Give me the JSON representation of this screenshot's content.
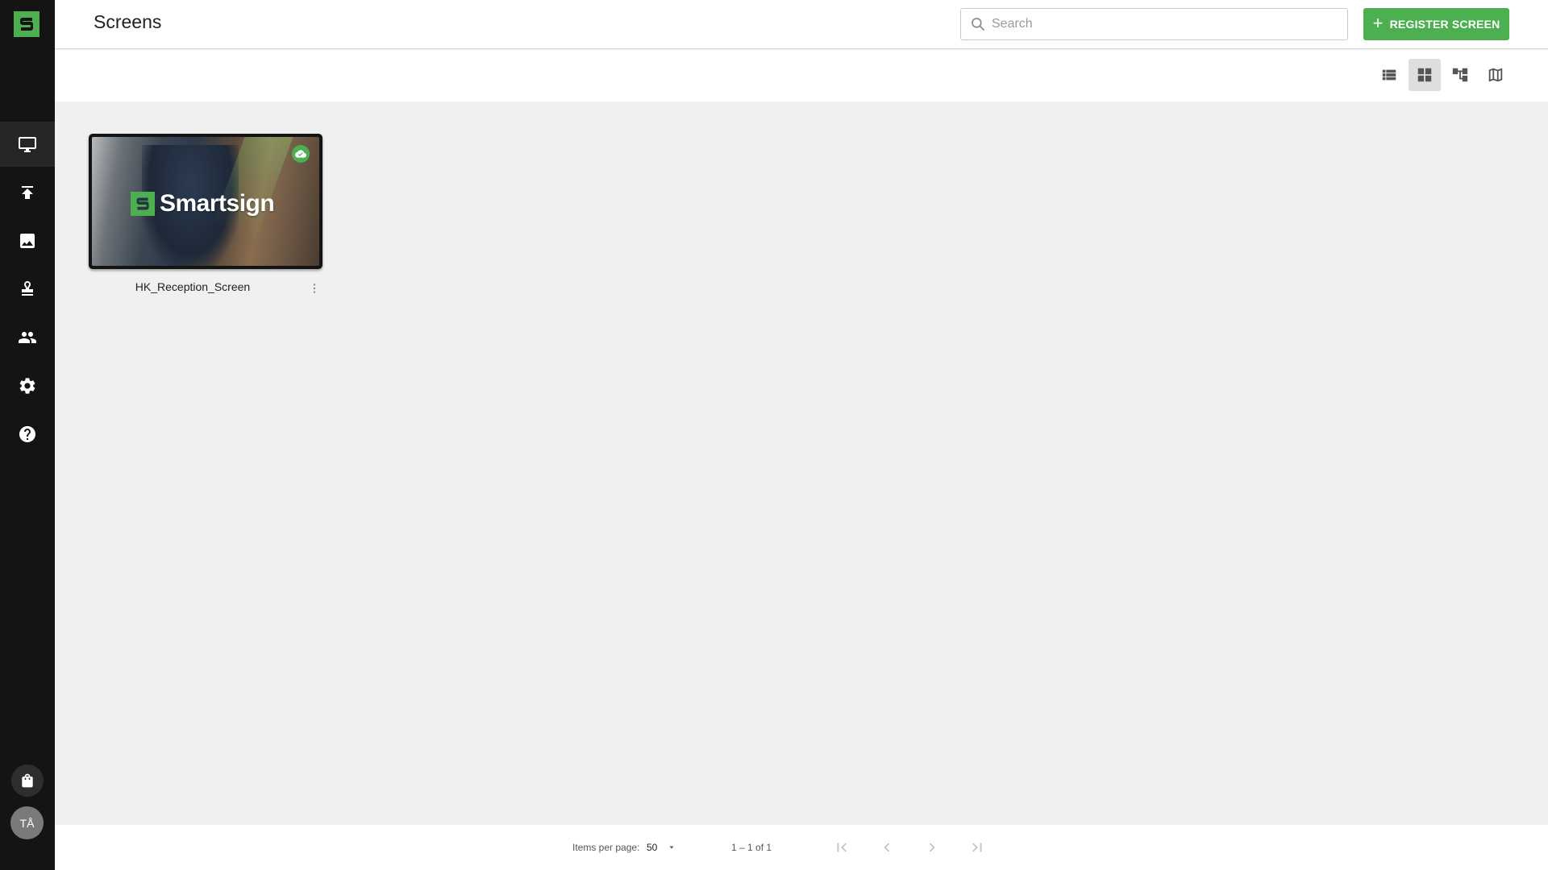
{
  "header": {
    "title": "Screens",
    "search_placeholder": "Search",
    "register_label": "REGISTER SCREEN"
  },
  "sidebar": {
    "items": [
      {
        "icon": "monitor-icon",
        "name": "screens",
        "active": true
      },
      {
        "icon": "upload-icon",
        "name": "publish",
        "active": false
      },
      {
        "icon": "image-icon",
        "name": "media",
        "active": false
      },
      {
        "icon": "stamp-icon",
        "name": "templates",
        "active": false
      },
      {
        "icon": "people-icon",
        "name": "users",
        "active": false
      },
      {
        "icon": "gear-icon",
        "name": "settings",
        "active": false
      },
      {
        "icon": "help-icon",
        "name": "help",
        "active": false
      }
    ],
    "shop_icon": "shopping-bag-icon",
    "avatar_initials": "TÅ"
  },
  "toolbar": {
    "views": [
      {
        "icon": "list-view-icon",
        "active": false
      },
      {
        "icon": "grid-view-icon",
        "active": true
      },
      {
        "icon": "tree-view-icon",
        "active": false
      },
      {
        "icon": "map-view-icon",
        "active": false
      }
    ]
  },
  "screens": [
    {
      "name": "HK_Reception_Screen",
      "thumbnail_text": "Smartsign",
      "status_icon": "cloud-done-icon"
    }
  ],
  "paginator": {
    "items_per_page_label": "Items per page:",
    "items_per_page_value": "50",
    "range_label": "1 – 1 of 1"
  },
  "colors": {
    "accent": "#4caf50",
    "sidebar_bg": "#141414",
    "content_bg": "#f0f0f0"
  }
}
